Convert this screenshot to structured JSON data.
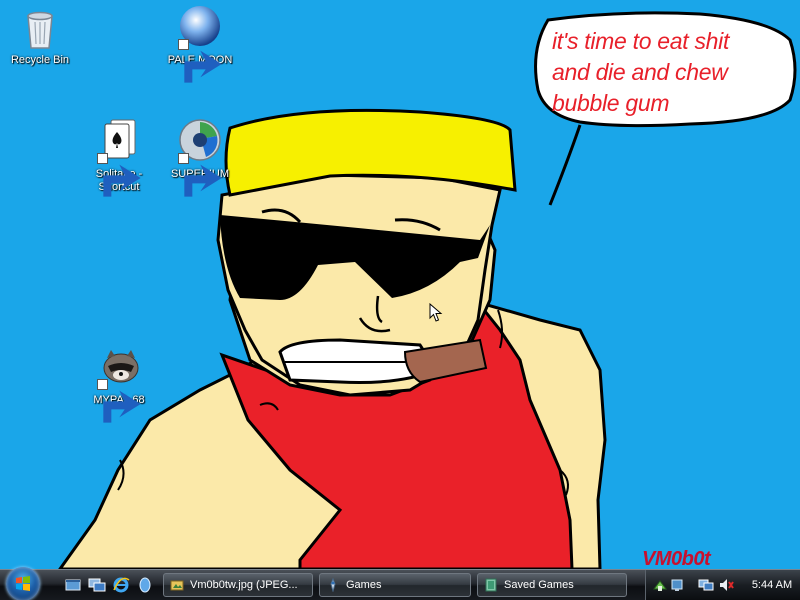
{
  "desktop": {
    "background_color": "#1aa6e9",
    "icons": [
      {
        "label": "Recycle Bin",
        "icon": "recycle-bin-icon"
      },
      {
        "label": "PALE MOON",
        "icon": "pale-moon-icon"
      },
      {
        "label": "Solitaire -\nShortcut",
        "icon": "solitaire-icon"
      },
      {
        "label": "SUPERIUM",
        "icon": "superium-icon"
      },
      {
        "label": "MYPAL 68",
        "icon": "mypal-icon"
      }
    ],
    "wallpaper": {
      "speech_bubble_lines": [
        "it's time to eat shit",
        "and die and chew",
        "bubble gum"
      ],
      "text_color": "#e8202a",
      "signature": "VM0b0t",
      "colors": {
        "hair": "#f7f000",
        "skin": "#fbe9a9",
        "shirt": "#ea2129",
        "glasses": "#000000",
        "cigar": "#a4664f"
      }
    }
  },
  "taskbar": {
    "start_button": "windows-start-orb",
    "quick_launch": [
      "show-desktop-icon",
      "switch-windows-icon",
      "internet-explorer-icon",
      "media-icon"
    ],
    "buttons": [
      {
        "label": "Vm0b0tw.jpg (JPEG...",
        "icon": "image-viewer-icon"
      },
      {
        "label": "Games",
        "icon": "games-icon"
      },
      {
        "label": "Saved Games",
        "icon": "folder-icon"
      }
    ],
    "tray_icons": [
      "network-icon",
      "volume-muted-icon",
      "display-icon",
      "speaker-icon"
    ],
    "clock": "5:44 AM"
  }
}
